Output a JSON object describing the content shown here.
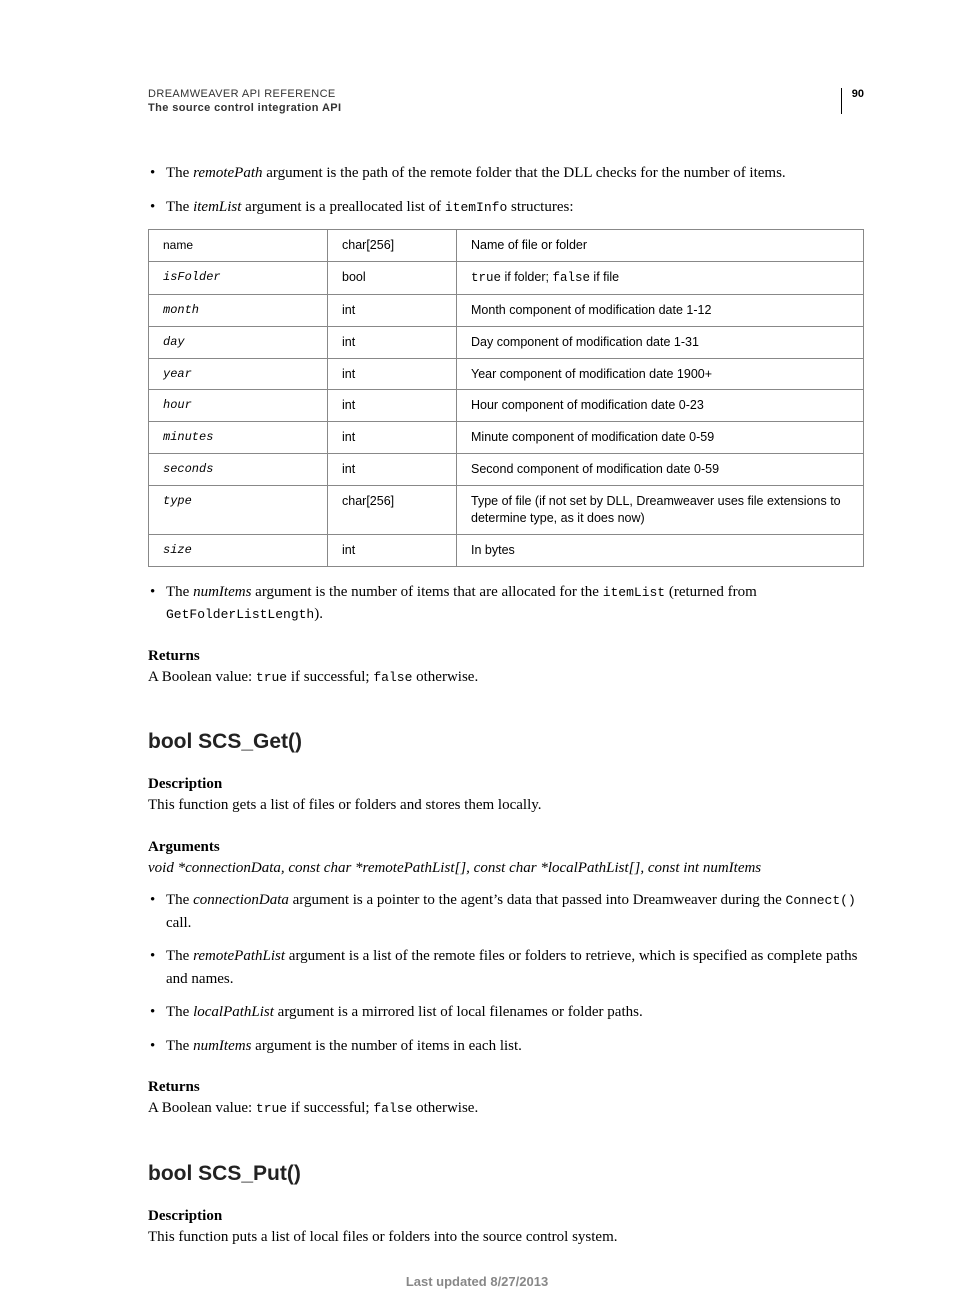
{
  "header": {
    "title": "DREAMWEAVER API REFERENCE",
    "subtitle": "The source control integration API",
    "page_number": "90"
  },
  "intro_bullets": {
    "b1_pre": "The ",
    "b1_arg": "remotePath",
    "b1_post": " argument is the path of the remote folder that the DLL checks for the number of items.",
    "b2_pre": "The ",
    "b2_arg": "itemList",
    "b2_mid": " argument is a preallocated list of ",
    "b2_code": "itemInfo",
    "b2_post": " structures:"
  },
  "table": [
    {
      "name": "name",
      "nomono": true,
      "type": "char[256]",
      "desc": "Name of file or folder"
    },
    {
      "name": "isFolder",
      "type": "bool",
      "desc_rich": true,
      "d_a": "true",
      "d_b": " if folder; ",
      "d_c": "false",
      "d_d": " if file"
    },
    {
      "name": "month",
      "type": "int",
      "desc": "Month component of modification date 1-12"
    },
    {
      "name": "day",
      "type": "int",
      "desc": "Day component of modification date 1-31"
    },
    {
      "name": "year",
      "type": "int",
      "desc": "Year component of modification date 1900+"
    },
    {
      "name": "hour",
      "type": "int",
      "desc": "Hour component of modification date 0-23"
    },
    {
      "name": "minutes",
      "type": "int",
      "desc": "Minute component of modification date 0-59"
    },
    {
      "name": "seconds",
      "type": "int",
      "desc": "Second component of modification date 0-59"
    },
    {
      "name": "type",
      "type": "char[256]",
      "desc": "Type of file (if not set by DLL, Dreamweaver uses file extensions to determine type, as it does now)"
    },
    {
      "name": "size",
      "type": "int",
      "desc": "In bytes"
    }
  ],
  "post_table": {
    "pre": "The ",
    "arg": "numItems",
    "mid": " argument is the number of items that are allocated for the ",
    "code1": "itemList",
    "mid2": " (returned from ",
    "code2": "GetFolderListLength",
    "post": ")."
  },
  "returns": {
    "label": "Returns",
    "pre": "A Boolean value: ",
    "c1": "true",
    "mid": " if successful; ",
    "c2": "false",
    "post": " otherwise."
  },
  "scs_get": {
    "heading": "bool SCS_Get()",
    "desc_label": "Description",
    "desc_text": "This function gets a list of files or folders and stores them locally.",
    "args_label": "Arguments",
    "args_sig": "void *connectionData, const char *remotePathList[], const char *localPathList[], const int numItems",
    "b1_pre": "The ",
    "b1_arg": "connectionData",
    "b1_mid": " argument is a pointer to the agent’s data that passed into Dreamweaver during the ",
    "b1_code": "Connect()",
    "b1_post": " call.",
    "b2_pre": "The ",
    "b2_arg": "remotePathList",
    "b2_post": " argument is a list of the remote files or folders to retrieve, which is specified as complete paths and names.",
    "b3_pre": "The ",
    "b3_arg": "localPathList",
    "b3_post": " argument is a mirrored list of local filenames or folder paths.",
    "b4_pre": "The ",
    "b4_arg": "numItems",
    "b4_post": " argument is the number of items in each list."
  },
  "scs_put": {
    "heading": "bool SCS_Put()",
    "desc_label": "Description",
    "desc_text": "This function puts a list of local files or folders into the source control system."
  },
  "footer": "Last updated 8/27/2013"
}
